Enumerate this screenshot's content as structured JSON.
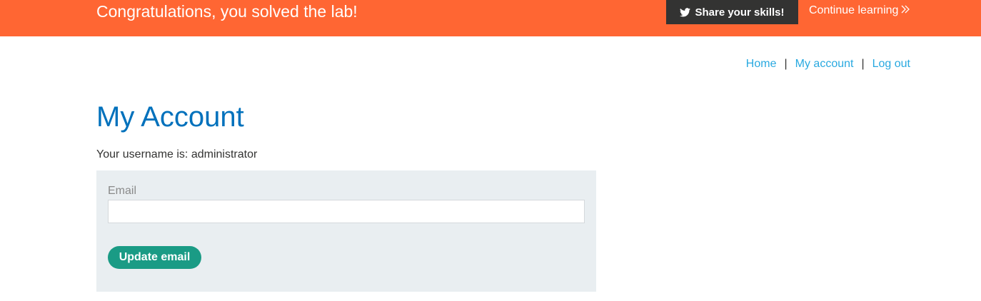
{
  "banner": {
    "message": "Congratulations, you solved the lab!",
    "share_label": "Share your skills!",
    "continue_label": "Continue learning",
    "share_icon": "twitter-icon",
    "continue_icon": "double-chevron-right-icon",
    "color": "#ff6633"
  },
  "nav": {
    "home": "Home",
    "separator_1": "|",
    "my_account": "My account",
    "separator_2": "|",
    "log_out": "Log out",
    "link_color": "#29a9e0"
  },
  "main": {
    "title": "My Account",
    "username_text": "Your username is: administrator",
    "title_color": "#0071bc"
  },
  "form": {
    "email_label": "Email",
    "email_value": "",
    "submit_label": "Update email",
    "submit_color": "#1a9b85",
    "panel_color": "#e9eef1"
  }
}
